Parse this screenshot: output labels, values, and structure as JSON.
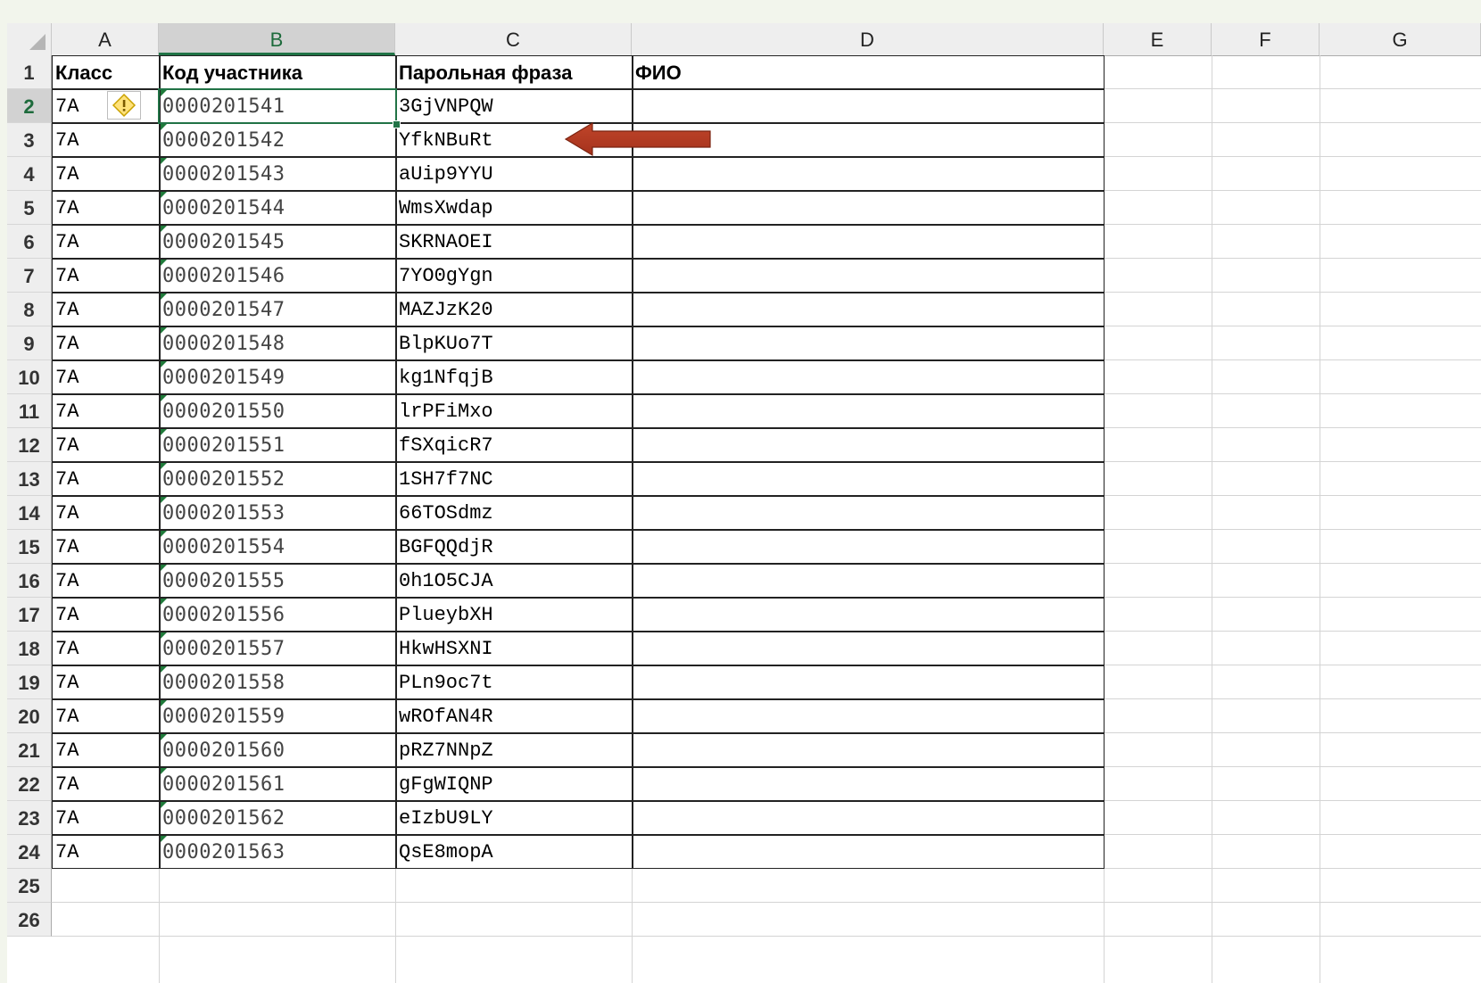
{
  "columns": [
    "A",
    "B",
    "C",
    "D",
    "E",
    "F",
    "G"
  ],
  "selected_column": "B",
  "selected_row": 2,
  "row_numbers": [
    "1",
    "2",
    "3",
    "4",
    "5",
    "6",
    "7",
    "8",
    "9",
    "10",
    "11",
    "12",
    "13",
    "14",
    "15",
    "16",
    "17",
    "18",
    "19",
    "20",
    "21",
    "22",
    "23",
    "24",
    "25",
    "26"
  ],
  "headers": {
    "class": "Класс",
    "code": "Код участника",
    "password": "Парольная фраза",
    "fio": "ФИО"
  },
  "rows": [
    {
      "class": "7А",
      "code": "0000201541",
      "password": "3GjVNPQW"
    },
    {
      "class": "7А",
      "code": "0000201542",
      "password": "YfkNBuRt"
    },
    {
      "class": "7А",
      "code": "0000201543",
      "password": "aUip9YYU"
    },
    {
      "class": "7А",
      "code": "0000201544",
      "password": "WmsXwdap"
    },
    {
      "class": "7А",
      "code": "0000201545",
      "password": "SKRNAOEI"
    },
    {
      "class": "7А",
      "code": "0000201546",
      "password": "7YO0gYgn"
    },
    {
      "class": "7А",
      "code": "0000201547",
      "password": "MAZJzK20"
    },
    {
      "class": "7А",
      "code": "0000201548",
      "password": "BlpKUo7T"
    },
    {
      "class": "7А",
      "code": "0000201549",
      "password": "kg1NfqjB"
    },
    {
      "class": "7А",
      "code": "0000201550",
      "password": "lrPFiMxo"
    },
    {
      "class": "7А",
      "code": "0000201551",
      "password": "fSXqicR7"
    },
    {
      "class": "7А",
      "code": "0000201552",
      "password": "1SH7f7NC"
    },
    {
      "class": "7А",
      "code": "0000201553",
      "password": "66TOSdmz"
    },
    {
      "class": "7А",
      "code": "0000201554",
      "password": "BGFQQdjR"
    },
    {
      "class": "7А",
      "code": "0000201555",
      "password": "0h1O5CJA"
    },
    {
      "class": "7А",
      "code": "0000201556",
      "password": "PlueybXH"
    },
    {
      "class": "7А",
      "code": "0000201557",
      "password": "HkwHSXNI"
    },
    {
      "class": "7А",
      "code": "0000201558",
      "password": "PLn9oc7t"
    },
    {
      "class": "7А",
      "code": "0000201559",
      "password": "wROfAN4R"
    },
    {
      "class": "7А",
      "code": "0000201560",
      "password": "pRZ7NNpZ"
    },
    {
      "class": "7А",
      "code": "0000201561",
      "password": "gFgWIQNP"
    },
    {
      "class": "7А",
      "code": "0000201562",
      "password": "eIzbU9LY"
    },
    {
      "class": "7А",
      "code": "0000201563",
      "password": "QsE8mopA"
    }
  ],
  "icons": {
    "warning": "warning-diamond-icon",
    "arrow": "left-arrow-annotation"
  },
  "colors": {
    "accent": "#217346",
    "arrow": "#a5321c",
    "header_bg": "#eeeeee"
  }
}
